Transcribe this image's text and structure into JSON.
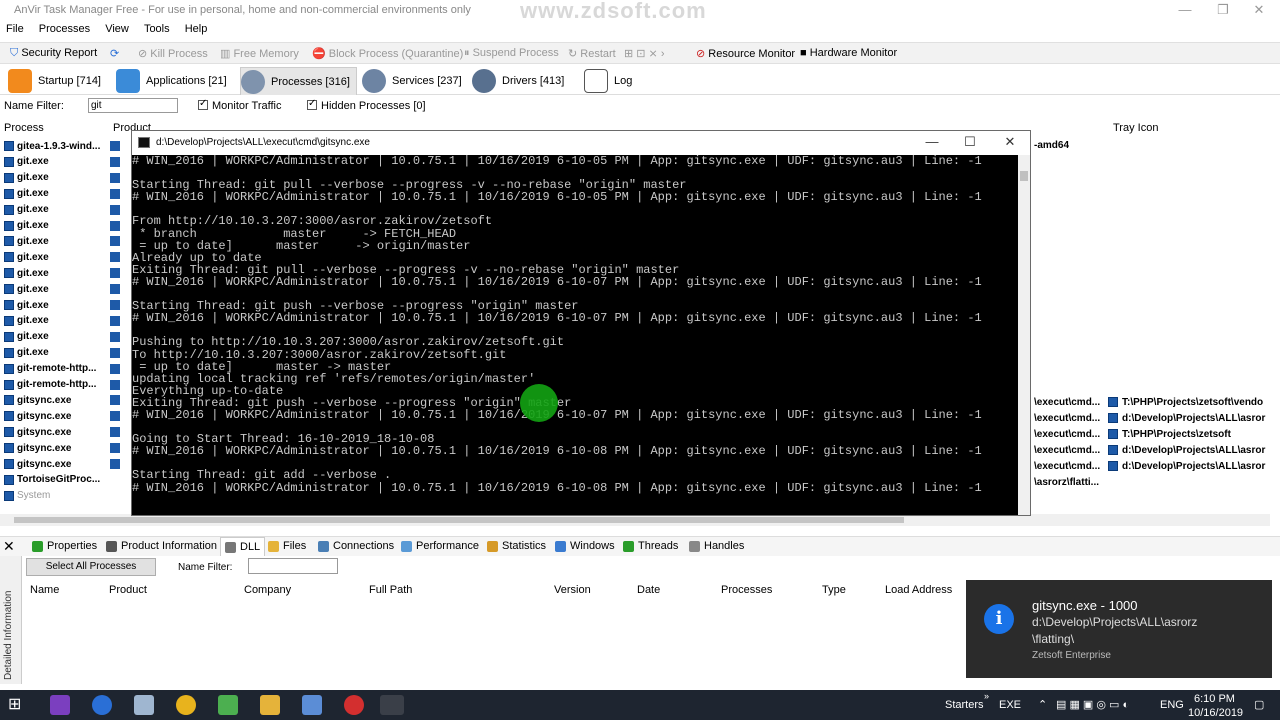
{
  "window": {
    "title": "AnVir Task Manager Free - For use in personal, home and non-commercial environments only",
    "watermark": "www.zdsoft.com"
  },
  "menu": [
    "File",
    "Processes",
    "View",
    "Tools",
    "Help"
  ],
  "toolbar": {
    "security_report": "Security Report",
    "kill_process": "Kill Process",
    "free_memory": "Free Memory",
    "block_process": "Block Process (Quarantine)",
    "suspend_process": "Suspend Process",
    "restart": "Restart",
    "resource_monitor": "Resource Monitor",
    "hardware_monitor": "Hardware Monitor"
  },
  "main_tabs": [
    {
      "label": "Startup [714]"
    },
    {
      "label": "Applications [21]"
    },
    {
      "label": "Processes [316]"
    },
    {
      "label": "Services [237]"
    },
    {
      "label": "Drivers [413]"
    },
    {
      "label": "Log"
    }
  ],
  "filter": {
    "label": "Name Filter:",
    "value": "git",
    "monitor_traffic": "Monitor Traffic",
    "hidden_processes": "Hidden Processes [0]"
  },
  "columns": {
    "process": "Process",
    "product": "Product",
    "tray_icon": "Tray Icon",
    "arch": "-amd64"
  },
  "processes": [
    {
      "name": "gitea-1.9.3-wind..."
    },
    {
      "name": "git.exe"
    },
    {
      "name": "git.exe"
    },
    {
      "name": "git.exe"
    },
    {
      "name": "git.exe"
    },
    {
      "name": "git.exe"
    },
    {
      "name": "git.exe"
    },
    {
      "name": "git.exe"
    },
    {
      "name": "git.exe"
    },
    {
      "name": "git.exe"
    },
    {
      "name": "git.exe"
    },
    {
      "name": "git.exe"
    },
    {
      "name": "git.exe"
    },
    {
      "name": "git.exe"
    },
    {
      "name": "git-remote-http..."
    },
    {
      "name": "git-remote-http..."
    },
    {
      "name": "gitsync.exe"
    },
    {
      "name": "gitsync.exe"
    },
    {
      "name": "gitsync.exe"
    },
    {
      "name": "gitsync.exe"
    },
    {
      "name": "gitsync.exe"
    },
    {
      "name": "TortoiseGitProc..."
    },
    {
      "name": "System"
    }
  ],
  "right_rows": [
    {
      "cmd": "\\execut\\cmd...",
      "tray": "T:\\PHP\\Projects\\zetsoft\\vendo"
    },
    {
      "cmd": "\\execut\\cmd...",
      "tray": "d:\\Develop\\Projects\\ALL\\asror"
    },
    {
      "cmd": "\\execut\\cmd...",
      "tray": "T:\\PHP\\Projects\\zetsoft"
    },
    {
      "cmd": "\\execut\\cmd...",
      "tray": "d:\\Develop\\Projects\\ALL\\asror"
    },
    {
      "cmd": "\\execut\\cmd...",
      "tray": "d:\\Develop\\Projects\\ALL\\asror"
    },
    {
      "cmd": "\\asrorz\\flatti...",
      "tray": ""
    }
  ],
  "console": {
    "title": "d:\\Develop\\Projects\\ALL\\execut\\cmd\\gitsync.exe",
    "lines": [
      "# WIN_2016 | WORKPC/Administrator | 10.0.75.1 | 10/16/2019 6-10-05 PM | App: gitsync.exe | UDF: gitsync.au3 | Line: -1",
      "",
      "Starting Thread: git pull --verbose --progress -v --no-rebase \"origin\" master",
      "# WIN_2016 | WORKPC/Administrator | 10.0.75.1 | 10/16/2019 6-10-05 PM | App: gitsync.exe | UDF: gitsync.au3 | Line: -1",
      "",
      "From http://10.10.3.207:3000/asror.zakirov/zetsoft",
      " * branch            master     -> FETCH_HEAD",
      " = up to date]      master     -> origin/master",
      "Already up to date",
      "Exiting Thread: git pull --verbose --progress -v --no-rebase \"origin\" master",
      "# WIN_2016 | WORKPC/Administrator | 10.0.75.1 | 10/16/2019 6-10-07 PM | App: gitsync.exe | UDF: gitsync.au3 | Line: -1",
      "",
      "Starting Thread: git push --verbose --progress \"origin\" master",
      "# WIN_2016 | WORKPC/Administrator | 10.0.75.1 | 10/16/2019 6-10-07 PM | App: gitsync.exe | UDF: gitsync.au3 | Line: -1",
      "",
      "Pushing to http://10.10.3.207:3000/asror.zakirov/zetsoft.git",
      "To http://10.10.3.207:3000/asror.zakirov/zetsoft.git",
      " = up to date]      master -> master",
      "updating local tracking ref 'refs/remotes/origin/master'",
      "Everything up-to-date",
      "Exiting Thread: git push --verbose --progress \"origin\" master",
      "# WIN_2016 | WORKPC/Administrator | 10.0.75.1 | 10/16/2019 6-10-07 PM | App: gitsync.exe | UDF: gitsync.au3 | Line: -1",
      "",
      "Going to Start Thread: 16-10-2019_18-10-08",
      "# WIN_2016 | WORKPC/Administrator | 10.0.75.1 | 10/16/2019 6-10-08 PM | App: gitsync.exe | UDF: gitsync.au3 | Line: -1",
      "",
      "Starting Thread: git add --verbose .",
      "# WIN_2016 | WORKPC/Administrator | 10.0.75.1 | 10/16/2019 6-10-08 PM | App: gitsync.exe | UDF: gitsync.au3 | Line: -1"
    ]
  },
  "bottom_tabs": [
    "Properties",
    "Product Information",
    "DLL",
    "Files",
    "Connections",
    "Performance",
    "Statistics",
    "Windows",
    "Threads",
    "Handles"
  ],
  "detail": {
    "sidebar_label": "Detailed Information",
    "select_all": "Select All Processes",
    "name_filter_label": "Name Filter:",
    "columns": [
      "Name",
      "Product",
      "Company",
      "Full Path",
      "Version",
      "Date",
      "Processes",
      "Type",
      "Load Address"
    ]
  },
  "toast": {
    "title": "gitsync.exe - 1000",
    "body": "d:\\Develop\\Projects\\ALL\\asrorz\n\\flatting\\",
    "footer": "Zetsoft Enterprise"
  },
  "taskbar": {
    "starters": "Starters",
    "exe": "EXE",
    "lang": "ENG",
    "time": "6:10 PM",
    "date": "10/16/2019"
  },
  "colors": {
    "taskbar": "#1e2530",
    "toast_bg": "#2b2b2b",
    "toast_icon": "#1a73e8",
    "cursor_highlight": "#13a313"
  }
}
